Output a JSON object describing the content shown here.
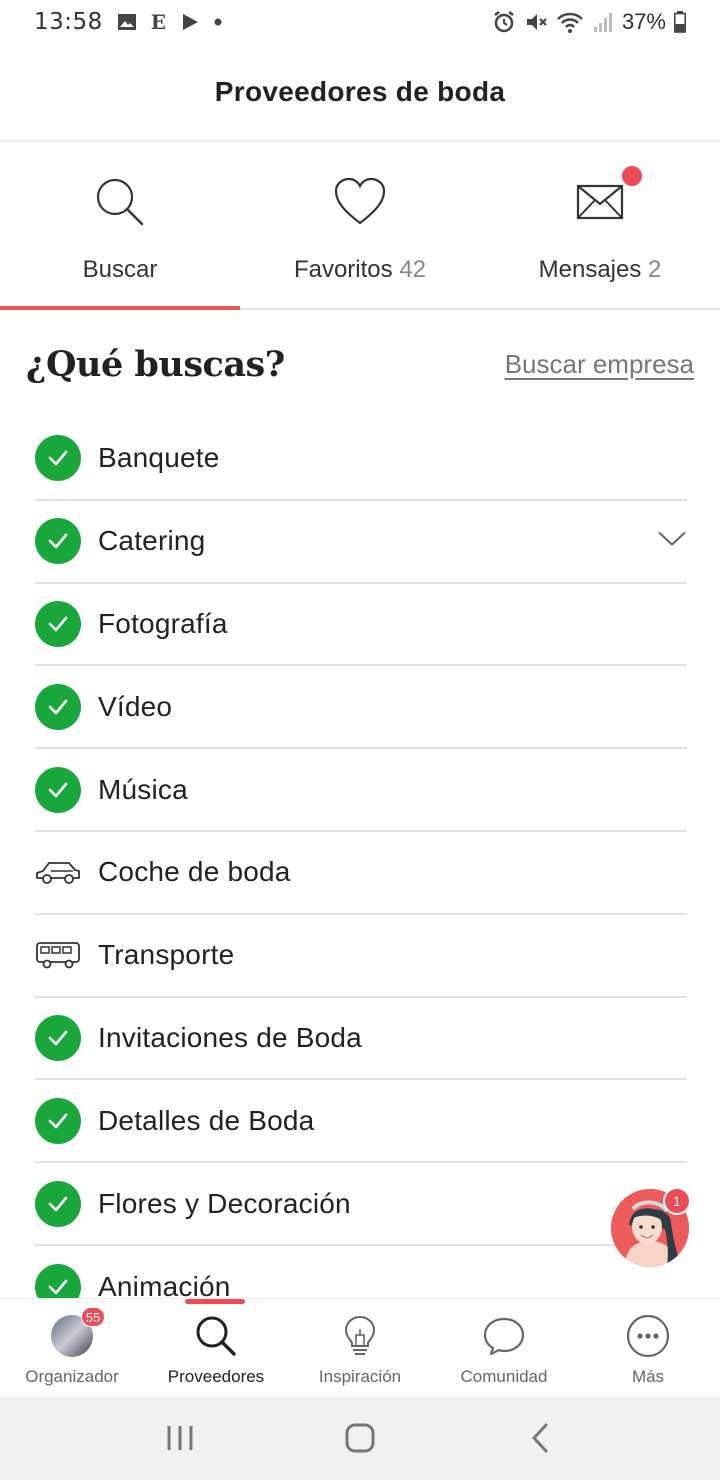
{
  "status_bar": {
    "time": "13:58",
    "battery": "37%",
    "left_icons": [
      "image-icon",
      "e-icon",
      "play-store-icon",
      "dot-icon"
    ],
    "right_icons": [
      "alarm-icon",
      "mute-icon",
      "wifi-icon",
      "signal-icon",
      "battery-icon"
    ]
  },
  "header": {
    "title": "Proveedores de boda"
  },
  "tabs": [
    {
      "label": "Buscar",
      "count": "",
      "icon": "search-icon",
      "active": true
    },
    {
      "label": "Favoritos",
      "count": "42",
      "icon": "heart-icon",
      "active": false
    },
    {
      "label": "Mensajes",
      "count": "2",
      "icon": "mail-icon",
      "active": false,
      "has_dot": true
    }
  ],
  "section": {
    "title": "¿Qué buscas?",
    "link": "Buscar empresa"
  },
  "categories": [
    {
      "label": "Banquete",
      "status": "checked"
    },
    {
      "label": "Catering",
      "status": "checked",
      "expandable": true
    },
    {
      "label": "Fotografía",
      "status": "checked"
    },
    {
      "label": "Vídeo",
      "status": "checked"
    },
    {
      "label": "Música",
      "status": "checked"
    },
    {
      "label": "Coche de boda",
      "status": "car-icon"
    },
    {
      "label": "Transporte",
      "status": "bus-icon"
    },
    {
      "label": "Invitaciones de Boda",
      "status": "checked"
    },
    {
      "label": "Detalles de Boda",
      "status": "checked"
    },
    {
      "label": "Flores y Decoración",
      "status": "checked"
    },
    {
      "label": "Animación",
      "status": "checked"
    }
  ],
  "assistant": {
    "badge": "1"
  },
  "bottom_nav": [
    {
      "label": "Organizador",
      "icon": "avatar",
      "badge": "55",
      "active": false
    },
    {
      "label": "Proveedores",
      "icon": "search-icon",
      "active": true
    },
    {
      "label": "Inspiración",
      "icon": "lightbulb-icon",
      "active": false
    },
    {
      "label": "Comunidad",
      "icon": "chat-bubble-icon",
      "active": false
    },
    {
      "label": "Más",
      "icon": "more-icon",
      "active": false
    }
  ],
  "colors": {
    "accent": "#ee4b56",
    "check_green": "#19a63b",
    "tab_underline": "#e45a5a"
  }
}
